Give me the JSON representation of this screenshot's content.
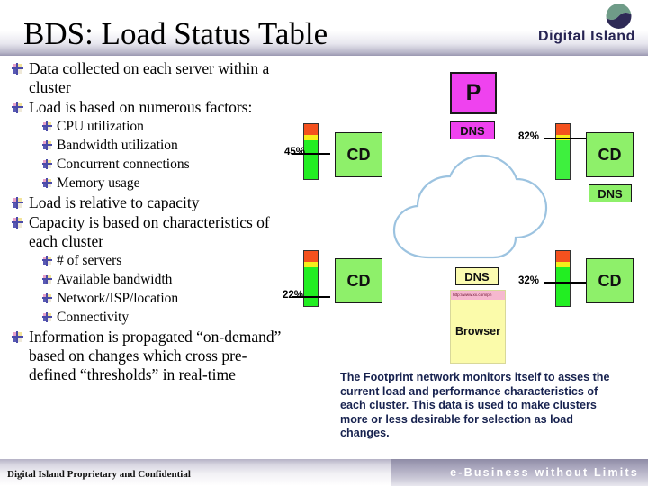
{
  "slide": {
    "title": "BDS: Load Status Table"
  },
  "logo": {
    "name": "Digital Island",
    "mark": "island-logo-icon",
    "colors": {
      "top": "#6f9c88",
      "bottom": "#2e2a56"
    }
  },
  "bullets": [
    {
      "level": 1,
      "text": "Data collected on each server within a cluster"
    },
    {
      "level": 1,
      "text": "Load is based on numerous factors:"
    },
    {
      "level": 2,
      "text": "CPU utilization"
    },
    {
      "level": 2,
      "text": "Bandwidth utilization"
    },
    {
      "level": 2,
      "text": "Concurrent connections"
    },
    {
      "level": 2,
      "text": "Memory usage"
    },
    {
      "level": 1,
      "text": "Load is relative to capacity"
    },
    {
      "level": 1,
      "text": "Capacity is based on characteristics of each cluster"
    },
    {
      "level": 2,
      "text": "# of servers"
    },
    {
      "level": 2,
      "text": "Available bandwidth"
    },
    {
      "level": 2,
      "text": "Network/ISP/location"
    },
    {
      "level": 2,
      "text": "Connectivity"
    },
    {
      "level": 1,
      "text": "Information is propagated “on-demand” based on changes which cross pre-defined “thresholds” in real-time"
    }
  ],
  "diagram": {
    "proxy_box_label": "P",
    "proxy_dns_label": "DNS",
    "cloud_label": "",
    "browser": {
      "url": "http://www.xx.com/ph",
      "label": "Browser",
      "dns_label": "DNS"
    },
    "clusters": [
      {
        "id": "cluster-top-left",
        "label": "CD",
        "load": "45%",
        "dns_label": ""
      },
      {
        "id": "cluster-top-right",
        "label": "CD",
        "load": "82%",
        "dns_label": "DNS"
      },
      {
        "id": "cluster-bottom-left",
        "label": "CD",
        "load": "22%",
        "dns_label": ""
      },
      {
        "id": "cluster-bottom-right",
        "label": "CD",
        "load": "32%",
        "dns_label": ""
      }
    ]
  },
  "caption": {
    "text": "The Footprint network monitors itself to asses the current load and performance characteristics of each cluster. This data is used to make clusters more or less desirable for selection as load changes."
  },
  "footer": {
    "left": "Digital Island Proprietary and Confidential",
    "right": "e-Business without Limits"
  }
}
